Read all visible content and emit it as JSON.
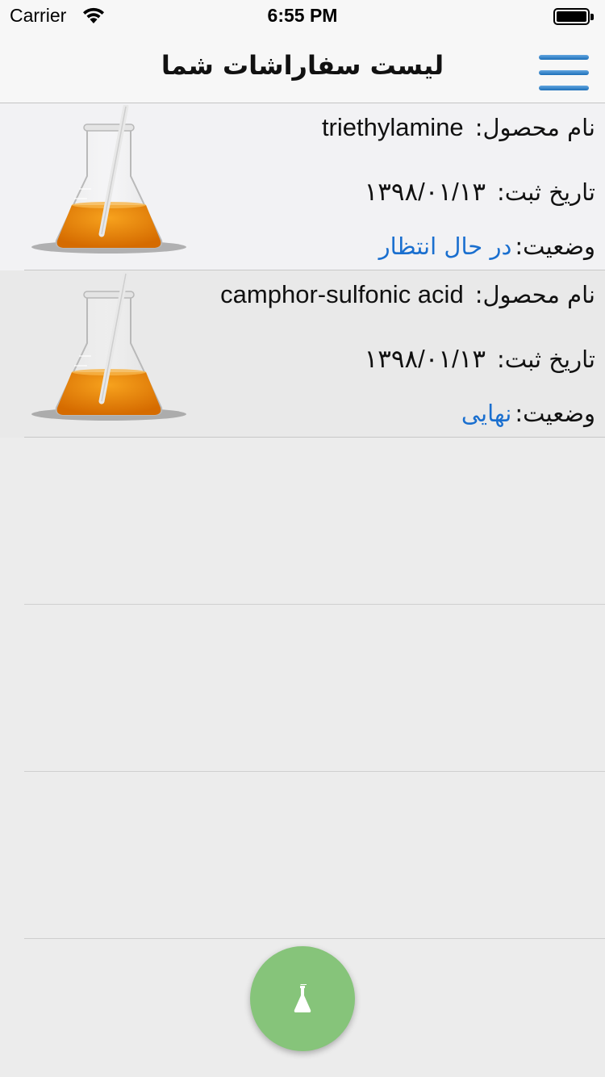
{
  "status_bar": {
    "carrier": "Carrier",
    "time": "6:55 PM",
    "icons": [
      "wifi-icon",
      "battery-icon"
    ]
  },
  "nav": {
    "title": "لیست سفاراشات شما",
    "menu_icon": "hamburger-menu-icon",
    "menu_color": "#2a7cc7"
  },
  "labels": {
    "product": "نام محصول:",
    "date": "تاریخ ثبت:",
    "status": "وضعیت:"
  },
  "orders": [
    {
      "product": "triethylamine",
      "date": "۱۳۹۸/۰۱/۱۳",
      "status": "در حال انتظار",
      "image": "flask-icon"
    },
    {
      "product": "camphor-sulfonic acid",
      "date": "۱۳۹۸/۰۱/۱۳",
      "status": "نهایی",
      "image": "flask-icon"
    }
  ],
  "fab": {
    "icon": "flask-icon",
    "color": "#86c47a"
  },
  "colors": {
    "status_text": "#1a6fcf",
    "liquid": "#f08c10"
  }
}
